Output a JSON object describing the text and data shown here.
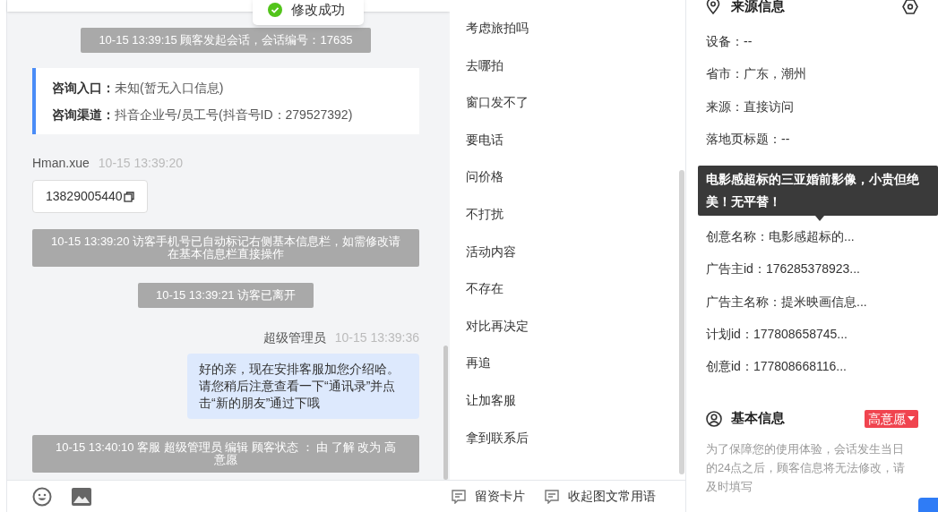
{
  "toast": {
    "text": "修改成功"
  },
  "chat": {
    "messages": [
      {
        "kind": "system",
        "text": "10-15 13:39:15 顾客发起会话，会话编号：17635"
      },
      {
        "kind": "info",
        "lines": [
          {
            "label": "咨询入口：",
            "value": "未知(暂无入口信息)"
          },
          {
            "label": "咨询渠道：",
            "value": "抖音企业号/员工号(抖音号ID：279527392)"
          }
        ]
      },
      {
        "kind": "visitor",
        "sender": "Hman.xue",
        "time": "10-15 13:39:20",
        "phone": "13829005440"
      },
      {
        "kind": "system",
        "text": "10-15 13:39:20 访客手机号已自动标记右侧基本信息栏，如需修改请在基本信息栏直接操作"
      },
      {
        "kind": "system",
        "text": "10-15 13:39:21 访客已离开"
      },
      {
        "kind": "agent",
        "sender": "超级管理员",
        "time": "10-15 13:39:36",
        "text": "好的亲，现在安排客服加您介绍哈。请您稍后注意查看一下“通讯录”并点击“新的朋友”通过下哦"
      },
      {
        "kind": "system",
        "text": "10-15 13:40:10 客服 超级管理员 编辑 顾客状态 ： 由 了解 改为 高意愿"
      }
    ]
  },
  "quick_phrases": [
    "考虑旅拍吗",
    "去哪拍",
    "窗口发不了",
    "要电话",
    "问价格",
    "不打扰",
    "活动内容",
    "不存在",
    "对比再决定",
    "再追",
    "让加客服",
    "拿到联系后"
  ],
  "footer_buttons": [
    "留资卡片",
    "收起图文常用语"
  ],
  "source_info": {
    "title": "来源信息",
    "rows": [
      "设备：--",
      "省市：广东，潮州",
      "来源：直接访问",
      "落地页标题：--",
      "创意名称：电影感超标的...",
      "广告主id：176285378923...",
      "广告主名称：提米映画信息...",
      "计划id：177808658745...",
      "创意id：177808668116..."
    ],
    "tooltip": {
      "text": "电影感超标的三亚婚前影像，小贵但绝美！无平替！"
    }
  },
  "basic_info": {
    "title": "基本信息",
    "intent": "高意愿",
    "notice": "为了保障您的使用体验，会话发生当日的24点之后，顾客信息将无法修改，请及时填写"
  }
}
